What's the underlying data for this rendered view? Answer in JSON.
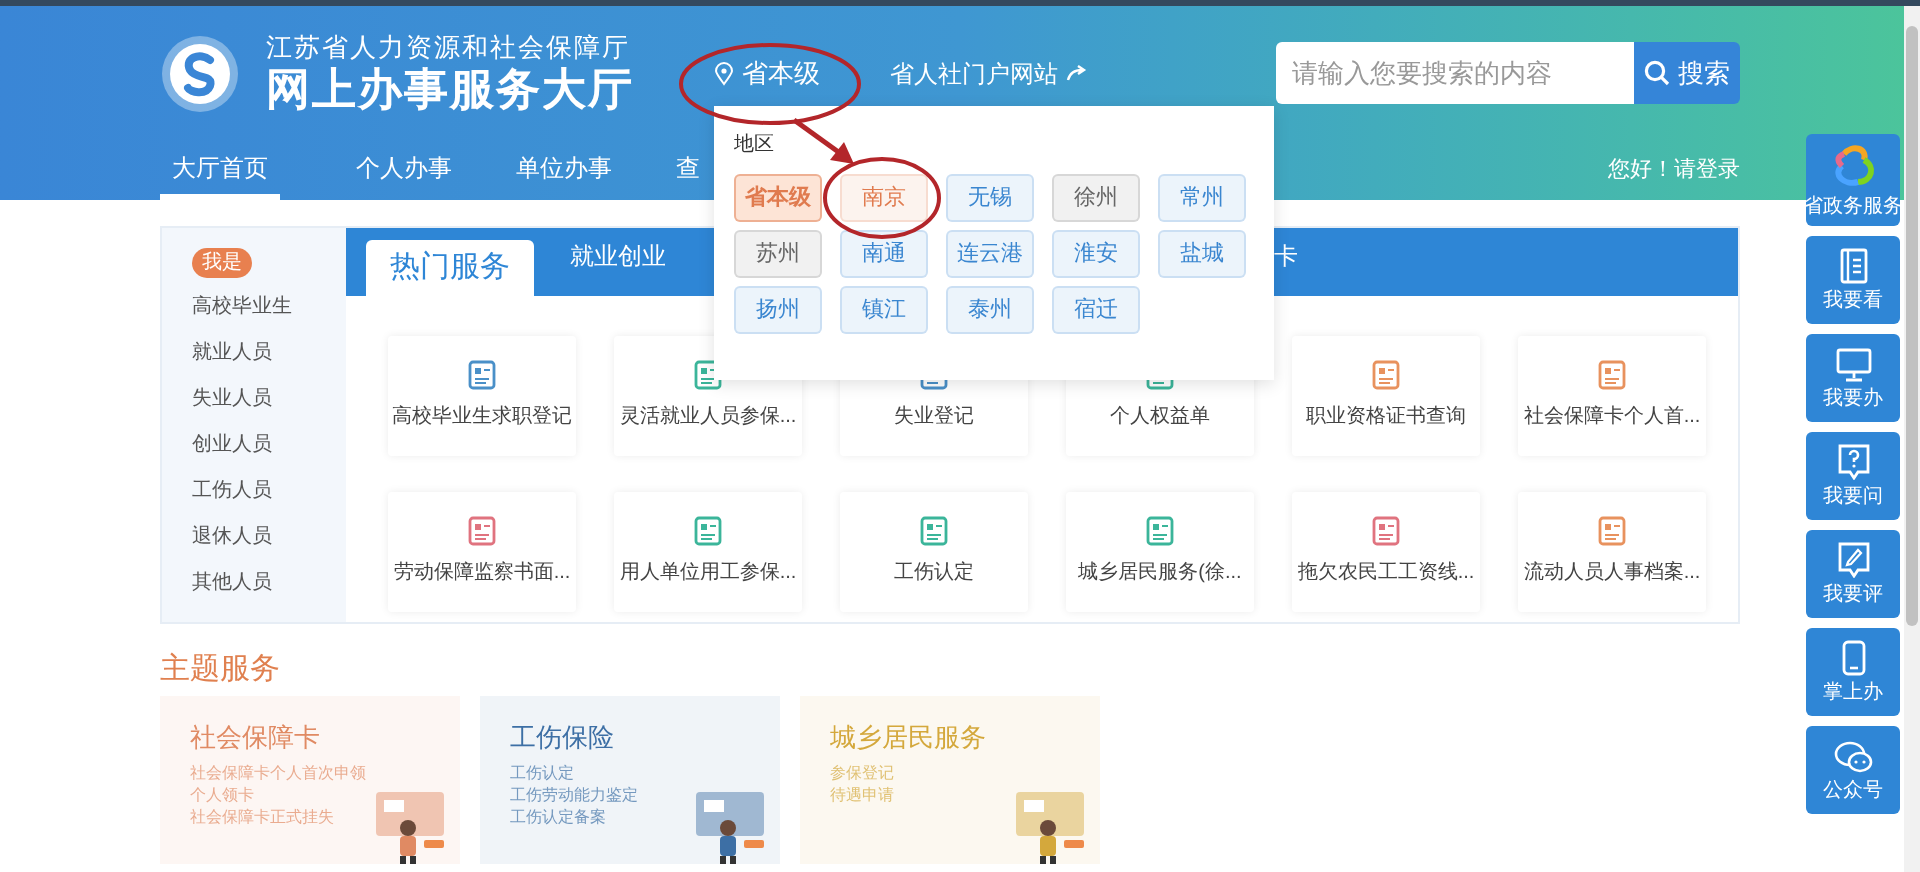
{
  "header": {
    "org_name": "江苏省人力资源和社会保障厅",
    "title": "网上办事服务大厅",
    "location": "省本级",
    "portal_link": "省人社门户网站",
    "search": {
      "placeholder": "请输入您要搜索的内容",
      "button": "搜索"
    },
    "nav": [
      {
        "label": "大厅首页",
        "selected": true
      },
      {
        "label": "个人办事",
        "selected": false
      },
      {
        "label": "单位办事",
        "selected": false
      },
      {
        "label": "查",
        "selected": false
      }
    ],
    "login": "您好！请登录"
  },
  "region_dropdown": {
    "label": "地区",
    "regions": [
      {
        "name": "省本级",
        "selected": true,
        "color": "#e07b4f"
      },
      {
        "name": "南京",
        "selected": false,
        "color": "#e07b4f"
      },
      {
        "name": "无锡",
        "selected": false,
        "color": "#3a86d0"
      },
      {
        "name": "徐州",
        "selected": false,
        "color": "#666666"
      },
      {
        "name": "常州",
        "selected": false,
        "color": "#3a86d0"
      },
      {
        "name": "苏州",
        "selected": false,
        "color": "#666666"
      },
      {
        "name": "南通",
        "selected": false,
        "color": "#3a86d0"
      },
      {
        "name": "连云港",
        "selected": false,
        "color": "#3a86d0"
      },
      {
        "name": "淮安",
        "selected": false,
        "color": "#3a86d0"
      },
      {
        "name": "盐城",
        "selected": false,
        "color": "#3a86d0"
      },
      {
        "name": "扬州",
        "selected": false,
        "color": "#3a86d0"
      },
      {
        "name": "镇江",
        "selected": false,
        "color": "#3a86d0"
      },
      {
        "name": "泰州",
        "selected": false,
        "color": "#3a86d0"
      },
      {
        "name": "宿迁",
        "selected": false,
        "color": "#3a86d0"
      }
    ]
  },
  "services": {
    "badge": "我是",
    "categories": [
      "高校毕业生",
      "就业人员",
      "失业人员",
      "创业人员",
      "工伤人员",
      "退休人员",
      "其他人员"
    ],
    "tabs": [
      {
        "label": "热门服务",
        "selected": true
      },
      {
        "label": "就业创业",
        "selected": false
      },
      {
        "label": "卡",
        "selected": false
      }
    ],
    "items": [
      {
        "label": "高校毕业生求职登记",
        "color": "#4a90c8"
      },
      {
        "label": "灵活就业人员参保...",
        "color": "#3bb59a"
      },
      {
        "label": "失业登记",
        "color": "#4a90c8"
      },
      {
        "label": "个人权益单",
        "color": "#3bb59a"
      },
      {
        "label": "职业资格证书查询",
        "color": "#e8925e"
      },
      {
        "label": "社会保障卡个人首...",
        "color": "#e8925e"
      },
      {
        "label": "劳动保障监察书面...",
        "color": "#e0737f"
      },
      {
        "label": "用人单位用工参保...",
        "color": "#3bb59a"
      },
      {
        "label": "工伤认定",
        "color": "#3bb59a"
      },
      {
        "label": "城乡居民服务(徐...",
        "color": "#3bb59a"
      },
      {
        "label": "拖欠农民工工资线...",
        "color": "#e0737f"
      },
      {
        "label": "流动人员人事档案...",
        "color": "#e8925e"
      }
    ]
  },
  "theme_services": {
    "title": "主题服务",
    "cards": [
      {
        "title": "社会保障卡",
        "color": "#e08a63",
        "links": [
          "社会保障卡个人首次申领",
          "个人领卡",
          "社会保障卡正式挂失"
        ]
      },
      {
        "title": "工伤保险",
        "color": "#3d6fa5",
        "links": [
          "工伤认定",
          "工伤劳动能力鉴定",
          "工伤认定备案"
        ]
      },
      {
        "title": "城乡居民服务",
        "color": "#d4a83c",
        "links": [
          "参保登记",
          "待遇申请"
        ]
      }
    ]
  },
  "side_toolbar": [
    {
      "label": "省政务服务",
      "kind": "logo"
    },
    {
      "label": "我要看",
      "kind": "book"
    },
    {
      "label": "我要办",
      "kind": "monitor"
    },
    {
      "label": "我要问",
      "kind": "question"
    },
    {
      "label": "我要评",
      "kind": "comment"
    },
    {
      "label": "掌上办",
      "kind": "phone"
    },
    {
      "label": "公众号",
      "kind": "chat"
    }
  ]
}
